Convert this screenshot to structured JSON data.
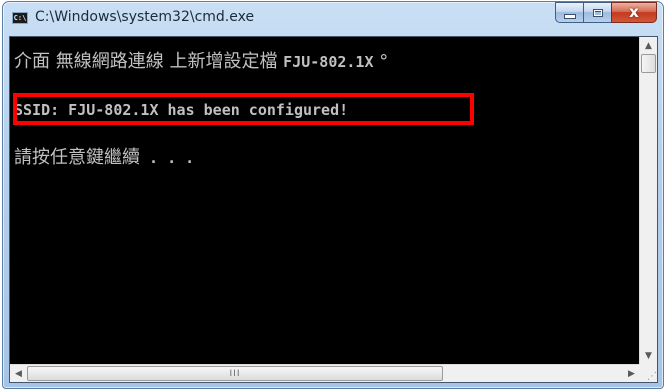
{
  "window": {
    "title": "C:\\Windows\\system32\\cmd.exe",
    "icon": "cmd-icon",
    "icon_glyph": "C:\\",
    "close_glyph": "x"
  },
  "console": {
    "lines": [
      {
        "part1": "介面 無線網路連線 上新增設定檔 ",
        "part2": "FJU-802.1X",
        "part3": " °"
      },
      {
        "text": "SSID: FJU-802.1X has been configured!"
      },
      {
        "part1": "請按任意鍵繼續",
        "part2": " . . ."
      }
    ],
    "highlight_color": "#ff0000",
    "text_color": "#c0c0c0",
    "background": "#000000"
  },
  "scrollbars": {
    "up_arrow": "▲",
    "down_arrow": "▼",
    "left_arrow": "◀",
    "right_arrow": "▶",
    "thumb_grip": "III",
    "size_grip": "⋰"
  }
}
